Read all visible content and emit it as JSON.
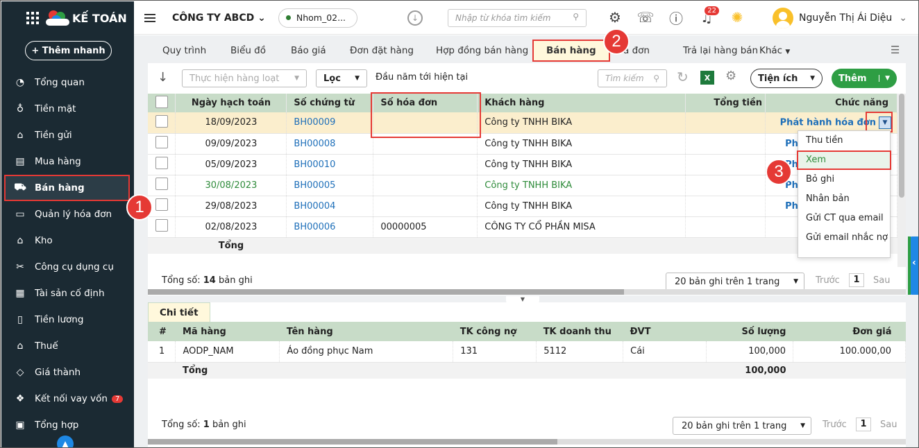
{
  "brand": {
    "name": "KẾ TOÁN"
  },
  "quick_add": "+ Thêm nhanh",
  "sidebar": {
    "items": [
      {
        "label": "Tổng quan",
        "icon": "dashboard-icon"
      },
      {
        "label": "Tiền mặt",
        "icon": "cash-icon"
      },
      {
        "label": "Tiền gửi",
        "icon": "bank-icon"
      },
      {
        "label": "Mua hàng",
        "icon": "purchase-icon"
      },
      {
        "label": "Bán hàng",
        "icon": "cart-icon",
        "active": true
      },
      {
        "label": "Quản lý hóa đơn",
        "icon": "invoice-icon"
      },
      {
        "label": "Kho",
        "icon": "warehouse-icon"
      },
      {
        "label": "Công cụ dụng cụ",
        "icon": "tools-icon"
      },
      {
        "label": "Tài sản cố định",
        "icon": "asset-icon"
      },
      {
        "label": "Tiền lương",
        "icon": "salary-icon"
      },
      {
        "label": "Thuế",
        "icon": "tax-icon"
      },
      {
        "label": "Giá thành",
        "icon": "price-tag-icon"
      },
      {
        "label": "Kết nối vay vốn",
        "icon": "loan-icon",
        "badge": "7"
      },
      {
        "label": "Tổng hợp",
        "icon": "report-icon"
      }
    ]
  },
  "topbar": {
    "company": "CÔNG TY ABCD",
    "group": "Nhom_02...",
    "search_placeholder": "Nhập từ khóa tìm kiếm",
    "notifications": "22",
    "user_name": "Nguyễn Thị Ái Diệu"
  },
  "tabs": [
    "Quy trình",
    "Biểu đồ",
    "Báo giá",
    "Đơn đặt hàng",
    "Hợp đồng bán hàng",
    "Bán hàng",
    "a đơn",
    "Trả lại hàng bán",
    "Khác"
  ],
  "toolbar": {
    "batch": "Thực hiện hàng loạt",
    "filter": "Lọc",
    "period": "Đầu năm tới hiện tại",
    "search_placeholder": "Tìm kiếm",
    "utility": "Tiện ích",
    "add": "Thêm"
  },
  "main_table": {
    "headers": [
      "Ngày hạch toán",
      "Số chứng từ",
      "Số hóa đơn",
      "Khách hàng",
      "Tổng tiền",
      "Chức năng"
    ],
    "rows": [
      {
        "date": "18/09/2023",
        "doc": "BH00009",
        "invoice": "",
        "customer": "Công ty TNHH BIKA",
        "action": "Phát hành hóa đơn",
        "selected": true
      },
      {
        "date": "09/09/2023",
        "doc": "BH00008",
        "invoice": "",
        "customer": "Công ty TNHH BIKA",
        "action": "Phá"
      },
      {
        "date": "05/09/2023",
        "doc": "BH00010",
        "invoice": "",
        "customer": "Công ty TNHH BIKA",
        "action": "Ph"
      },
      {
        "date": "30/08/2023",
        "doc": "BH00005",
        "invoice": "",
        "customer": "Công ty TNHH BIKA",
        "action": "Phá",
        "green": true
      },
      {
        "date": "29/08/2023",
        "doc": "BH00004",
        "invoice": "",
        "customer": "Công ty TNHH BIKA",
        "action": "Phá"
      },
      {
        "date": "02/08/2023",
        "doc": "BH00006",
        "invoice": "00000005",
        "customer": "CÔNG TY CỔ PHẦN MISA",
        "action": ""
      }
    ],
    "total_label": "Tổng",
    "count_prefix": "Tổng số:",
    "count_value": "14",
    "count_suffix": "bản ghi",
    "page_size": "20 bản ghi trên 1 trang",
    "prev": "Trước",
    "page": "1",
    "next": "Sau"
  },
  "action_menu": [
    "Thu tiền",
    "Xem",
    "Bỏ ghi",
    "Nhân bản",
    "Gửi CT qua email",
    "Gửi email nhắc nợ"
  ],
  "callouts": [
    "1",
    "2",
    "3"
  ],
  "detail": {
    "tab": "Chi tiết",
    "headers": [
      "#",
      "Mã hàng",
      "Tên hàng",
      "TK công nợ",
      "TK doanh thu",
      "ĐVT",
      "Số lượng",
      "Đơn giá"
    ],
    "rows": [
      {
        "no": "1",
        "code": "AODP_NAM",
        "name": "Áo đồng phục Nam",
        "debt": "131",
        "revenue": "5112",
        "unit": "Cái",
        "qty": "100,000",
        "price": "100.000,00"
      }
    ],
    "total_label": "Tổng",
    "total_qty": "100,000",
    "count_prefix": "Tổng số:",
    "count_value": "1",
    "count_suffix": "bản ghi",
    "page_size": "20 bản ghi trên 1 trang",
    "prev": "Trước",
    "page": "1",
    "next": "Sau"
  },
  "colors": {
    "accent_green": "#2e9e44",
    "highlight_red": "#e53935",
    "link_blue": "#1e6fb9",
    "sidebar_bg": "#1b2a33",
    "header_green": "#c8dcc8"
  }
}
